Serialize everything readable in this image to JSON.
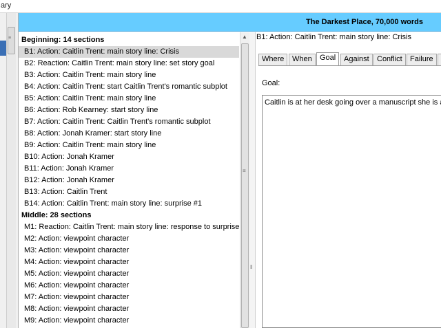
{
  "menu": {
    "partial_label": "ary"
  },
  "header": {
    "title": "The Darkest Place, 70,000 words"
  },
  "outline": {
    "rows": [
      {
        "kind": "hdr",
        "text": "Beginning: 14 sections"
      },
      {
        "kind": "sec",
        "text": "B1: Action: Caitlin Trent: main story line: Crisis",
        "selected": true
      },
      {
        "kind": "sec",
        "text": "B2: Reaction: Caitlin Trent: main story line: set story goal"
      },
      {
        "kind": "sec",
        "text": "B3: Action: Caitlin Trent: main story line"
      },
      {
        "kind": "sec",
        "text": "B4: Action: Caitlin Trent: start Caitlin Trent's romantic subplot"
      },
      {
        "kind": "sec",
        "text": "B5: Action: Caitlin Trent: main story line"
      },
      {
        "kind": "sec",
        "text": "B6: Action: Rob Kearney: start story line"
      },
      {
        "kind": "sec",
        "text": "B7: Action: Caitlin Trent: Caitlin Trent's romantic subplot"
      },
      {
        "kind": "sec",
        "text": "B8: Action: Jonah Kramer: start story line"
      },
      {
        "kind": "sec",
        "text": "B9: Action: Caitlin Trent: main story line"
      },
      {
        "kind": "sec",
        "text": "B10: Action: Jonah Kramer"
      },
      {
        "kind": "sec",
        "text": "B11: Action: Jonah Kramer"
      },
      {
        "kind": "sec",
        "text": "B12: Action: Jonah Kramer"
      },
      {
        "kind": "sec",
        "text": "B13: Action: Caitlin Trent"
      },
      {
        "kind": "sec",
        "text": "B14: Action: Caitlin Trent: main story line: surprise #1"
      },
      {
        "kind": "hdr",
        "text": "Middle: 28 sections"
      },
      {
        "kind": "sec",
        "text": "M1: Reaction: Caitlin Trent: main story line: response to surprise #1"
      },
      {
        "kind": "sec",
        "text": "M2: Action: viewpoint character"
      },
      {
        "kind": "sec",
        "text": "M3: Action: viewpoint character"
      },
      {
        "kind": "sec",
        "text": "M4: Action: viewpoint character"
      },
      {
        "kind": "sec",
        "text": "M5: Action: viewpoint character"
      },
      {
        "kind": "sec",
        "text": "M6: Action: viewpoint character"
      },
      {
        "kind": "sec",
        "text": "M7: Action: viewpoint character"
      },
      {
        "kind": "sec",
        "text": "M8: Action: viewpoint character"
      },
      {
        "kind": "sec",
        "text": "M9: Action: viewpoint character"
      }
    ]
  },
  "detail": {
    "heading": "B1: Action: Caitlin Trent: main story line: Crisis",
    "tabs": [
      {
        "label": "Where"
      },
      {
        "label": "When"
      },
      {
        "label": "Goal",
        "active": true
      },
      {
        "label": "Against"
      },
      {
        "label": "Conflict"
      },
      {
        "label": "Failure"
      },
      {
        "label": "M"
      }
    ],
    "goal_label": "Goal:",
    "goal_text": "Caitlin is at her desk going over a manuscript she is abou"
  },
  "colors": {
    "title_bar": "#66ccff",
    "selection": "#d9d9d9",
    "left_selection": "#3a6fb5"
  }
}
